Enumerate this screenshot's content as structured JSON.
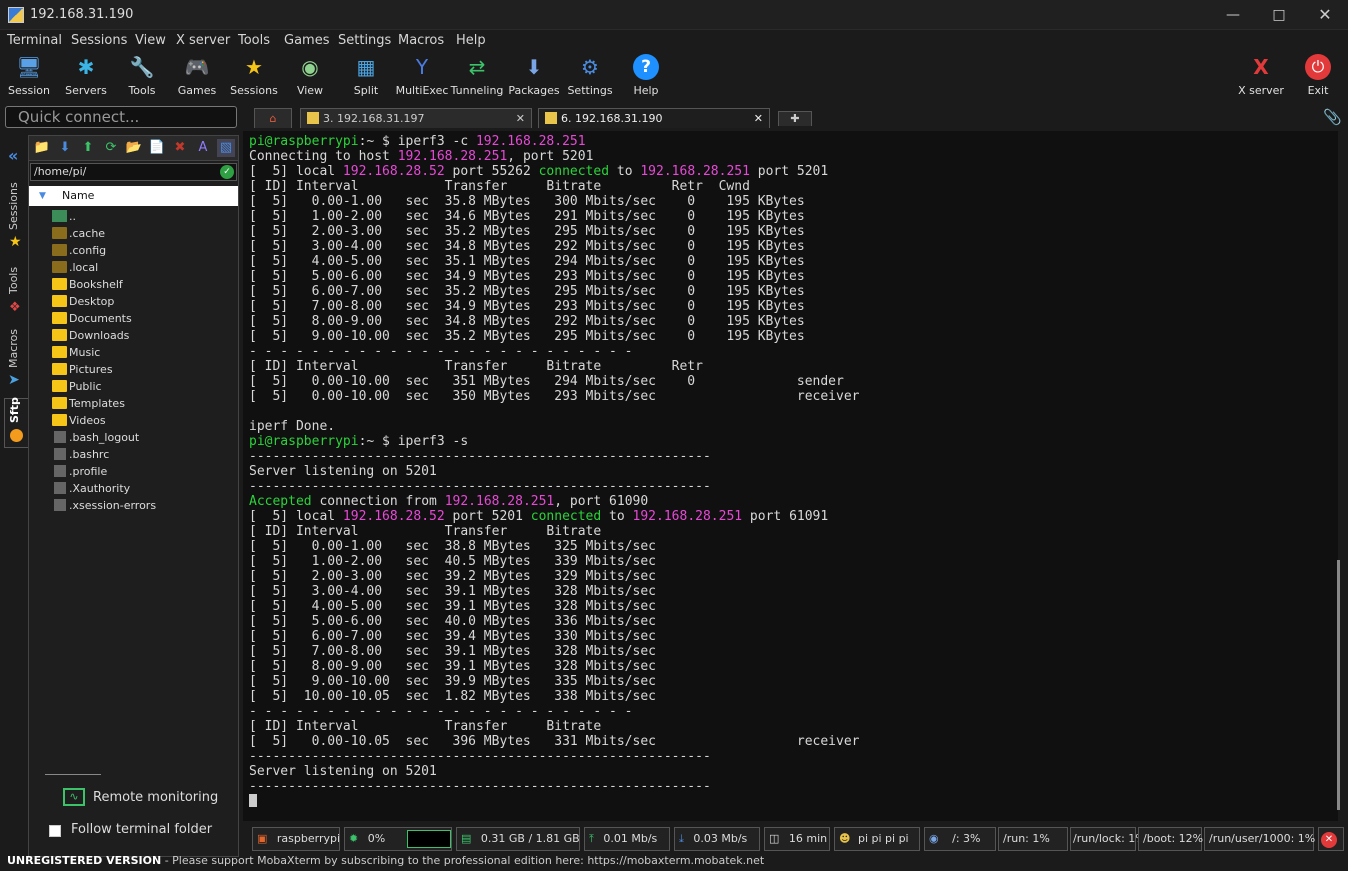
{
  "window": {
    "title": "192.168.31.190"
  },
  "menu": [
    "Terminal",
    "Sessions",
    "View",
    "X server",
    "Tools",
    "Games",
    "Settings",
    "Macros",
    "Help"
  ],
  "toolbar": {
    "items": [
      "Session",
      "Servers",
      "Tools",
      "Games",
      "Sessions",
      "View",
      "Split",
      "MultiExec",
      "Tunneling",
      "Packages",
      "Settings",
      "Help"
    ],
    "xserver": "X server",
    "exit": "Exit"
  },
  "quick_connect": {
    "placeholder": "Quick connect..."
  },
  "tabs": [
    {
      "label": "3. 192.168.31.197"
    },
    {
      "label": "6. 192.168.31.190",
      "active": true
    }
  ],
  "side_tabs": [
    "Sessions",
    "Tools",
    "Macros",
    "Sftp"
  ],
  "sftp": {
    "path": "/home/pi/",
    "column_name": "Name",
    "files": [
      {
        "name": "..",
        "type": "up"
      },
      {
        "name": ".cache",
        "type": "folder-dark"
      },
      {
        "name": ".config",
        "type": "folder-dark"
      },
      {
        "name": ".local",
        "type": "folder-dark"
      },
      {
        "name": "Bookshelf",
        "type": "folder"
      },
      {
        "name": "Desktop",
        "type": "folder"
      },
      {
        "name": "Documents",
        "type": "folder"
      },
      {
        "name": "Downloads",
        "type": "folder"
      },
      {
        "name": "Music",
        "type": "folder"
      },
      {
        "name": "Pictures",
        "type": "folder"
      },
      {
        "name": "Public",
        "type": "folder"
      },
      {
        "name": "Templates",
        "type": "folder"
      },
      {
        "name": "Videos",
        "type": "folder"
      },
      {
        "name": ".bash_logout",
        "type": "file"
      },
      {
        "name": ".bashrc",
        "type": "file"
      },
      {
        "name": ".profile",
        "type": "file"
      },
      {
        "name": ".Xauthority",
        "type": "doc"
      },
      {
        "name": ".xsession-errors",
        "type": "doc"
      }
    ],
    "remote_monitoring": "Remote monitoring",
    "follow_folder": "Follow terminal folder"
  },
  "terminal": {
    "lines": [
      [
        {
          "t": "pi@raspberrypi",
          "c": "g"
        },
        {
          "t": ":~ $ iperf3 -c "
        },
        {
          "t": "192.168.28.251",
          "c": "m"
        }
      ],
      [
        {
          "t": "Connecting to host "
        },
        {
          "t": "192.168.28.251",
          "c": "m"
        },
        {
          "t": ", port 5201"
        }
      ],
      [
        {
          "t": "[  5] local "
        },
        {
          "t": "192.168.28.52",
          "c": "m"
        },
        {
          "t": " port 55262 "
        },
        {
          "t": "connected",
          "c": "g"
        },
        {
          "t": " to "
        },
        {
          "t": "192.168.28.251",
          "c": "m"
        },
        {
          "t": " port 5201"
        }
      ],
      [
        {
          "t": "[ ID] Interval           Transfer     Bitrate         Retr  Cwnd"
        }
      ],
      [
        {
          "t": "[  5]   0.00-1.00   sec  35.8 MBytes   300 Mbits/sec    0    195 KBytes"
        }
      ],
      [
        {
          "t": "[  5]   1.00-2.00   sec  34.6 MBytes   291 Mbits/sec    0    195 KBytes"
        }
      ],
      [
        {
          "t": "[  5]   2.00-3.00   sec  35.2 MBytes   295 Mbits/sec    0    195 KBytes"
        }
      ],
      [
        {
          "t": "[  5]   3.00-4.00   sec  34.8 MBytes   292 Mbits/sec    0    195 KBytes"
        }
      ],
      [
        {
          "t": "[  5]   4.00-5.00   sec  35.1 MBytes   294 Mbits/sec    0    195 KBytes"
        }
      ],
      [
        {
          "t": "[  5]   5.00-6.00   sec  34.9 MBytes   293 Mbits/sec    0    195 KBytes"
        }
      ],
      [
        {
          "t": "[  5]   6.00-7.00   sec  35.2 MBytes   295 Mbits/sec    0    195 KBytes"
        }
      ],
      [
        {
          "t": "[  5]   7.00-8.00   sec  34.9 MBytes   293 Mbits/sec    0    195 KBytes"
        }
      ],
      [
        {
          "t": "[  5]   8.00-9.00   sec  34.8 MBytes   292 Mbits/sec    0    195 KBytes"
        }
      ],
      [
        {
          "t": "[  5]   9.00-10.00  sec  35.2 MBytes   295 Mbits/sec    0    195 KBytes"
        }
      ],
      [
        {
          "t": "- - - - - - - - - - - - - - - - - - - - - - - - -"
        }
      ],
      [
        {
          "t": "[ ID] Interval           Transfer     Bitrate         Retr"
        }
      ],
      [
        {
          "t": "[  5]   0.00-10.00  sec   351 MBytes   294 Mbits/sec    0             sender"
        }
      ],
      [
        {
          "t": "[  5]   0.00-10.00  sec   350 MBytes   293 Mbits/sec                  receiver"
        }
      ],
      [
        {
          "t": ""
        }
      ],
      [
        {
          "t": "iperf Done."
        }
      ],
      [
        {
          "t": "pi@raspberrypi",
          "c": "g"
        },
        {
          "t": ":~ $ iperf3 -s"
        }
      ],
      [
        {
          "t": "-----------------------------------------------------------"
        }
      ],
      [
        {
          "t": "Server listening on 5201"
        }
      ],
      [
        {
          "t": "-----------------------------------------------------------"
        }
      ],
      [
        {
          "t": "Accepted",
          "c": "g"
        },
        {
          "t": " connection from "
        },
        {
          "t": "192.168.28.251",
          "c": "m"
        },
        {
          "t": ", port 61090"
        }
      ],
      [
        {
          "t": "[  5] local "
        },
        {
          "t": "192.168.28.52",
          "c": "m"
        },
        {
          "t": " port 5201 "
        },
        {
          "t": "connected",
          "c": "g"
        },
        {
          "t": " to "
        },
        {
          "t": "192.168.28.251",
          "c": "m"
        },
        {
          "t": " port 61091"
        }
      ],
      [
        {
          "t": "[ ID] Interval           Transfer     Bitrate"
        }
      ],
      [
        {
          "t": "[  5]   0.00-1.00   sec  38.8 MBytes   325 Mbits/sec"
        }
      ],
      [
        {
          "t": "[  5]   1.00-2.00   sec  40.5 MBytes   339 Mbits/sec"
        }
      ],
      [
        {
          "t": "[  5]   2.00-3.00   sec  39.2 MBytes   329 Mbits/sec"
        }
      ],
      [
        {
          "t": "[  5]   3.00-4.00   sec  39.1 MBytes   328 Mbits/sec"
        }
      ],
      [
        {
          "t": "[  5]   4.00-5.00   sec  39.1 MBytes   328 Mbits/sec"
        }
      ],
      [
        {
          "t": "[  5]   5.00-6.00   sec  40.0 MBytes   336 Mbits/sec"
        }
      ],
      [
        {
          "t": "[  5]   6.00-7.00   sec  39.4 MBytes   330 Mbits/sec"
        }
      ],
      [
        {
          "t": "[  5]   7.00-8.00   sec  39.1 MBytes   328 Mbits/sec"
        }
      ],
      [
        {
          "t": "[  5]   8.00-9.00   sec  39.1 MBytes   328 Mbits/sec"
        }
      ],
      [
        {
          "t": "[  5]   9.00-10.00  sec  39.9 MBytes   335 Mbits/sec"
        }
      ],
      [
        {
          "t": "[  5]  10.00-10.05  sec  1.82 MBytes   338 Mbits/sec"
        }
      ],
      [
        {
          "t": "- - - - - - - - - - - - - - - - - - - - - - - - -"
        }
      ],
      [
        {
          "t": "[ ID] Interval           Transfer     Bitrate"
        }
      ],
      [
        {
          "t": "[  5]   0.00-10.05  sec   396 MBytes   331 Mbits/sec                  receiver"
        }
      ],
      [
        {
          "t": "-----------------------------------------------------------"
        }
      ],
      [
        {
          "t": "Server listening on 5201"
        }
      ],
      [
        {
          "t": "-----------------------------------------------------------"
        }
      ]
    ]
  },
  "status": {
    "host": "raspberrypi",
    "cpu": "0%",
    "memory": "0.31 GB / 1.81 GB",
    "upload": "0.01 Mb/s",
    "download": "0.03 Mb/s",
    "uptime": "16 min",
    "users": "pi  pi  pi  pi",
    "disk_root": "/: 3%",
    "disk_run": "/run: 1%",
    "disk_runlock": "/run/lock: 1%",
    "disk_boot": "/boot: 12%",
    "disk_runuser": "/run/user/1000: 1%"
  },
  "footer": {
    "unregistered": "UNREGISTERED VERSION",
    "message": "  -  Please support MobaXterm by subscribing to the professional edition here:",
    "url": "https://mobaxterm.mobatek.net"
  },
  "colors": {
    "prompt_green": "#2bd33a",
    "ip_magenta": "#e649d6",
    "accent_blue": "#1e90ff"
  }
}
